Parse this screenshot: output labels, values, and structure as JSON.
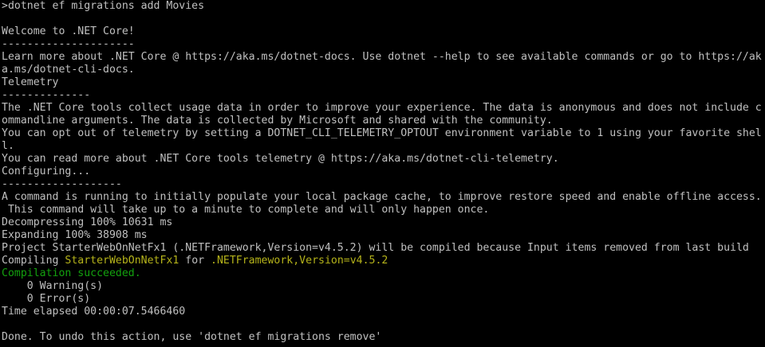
{
  "colors": {
    "background": "#000000",
    "default_text": "#c0c0c0",
    "dark_yellow": "#b5b31a",
    "green": "#13a10e"
  },
  "terminal": {
    "lines": [
      ">dotnet ef migrations add Movies",
      "",
      "Welcome to .NET Core!",
      "---------------------",
      "Learn more about .NET Core @ https://aka.ms/dotnet-docs. Use dotnet --help to see available commands or go to https://ak",
      "a.ms/dotnet-cli-docs.",
      "Telemetry",
      "--------------",
      "The .NET Core tools collect usage data in order to improve your experience. The data is anonymous and does not include c",
      "ommandline arguments. The data is collected by Microsoft and shared with the community.",
      "You can opt out of telemetry by setting a DOTNET_CLI_TELEMETRY_OPTOUT environment variable to 1 using your favorite shel",
      "l.",
      "You can read more about .NET Core tools telemetry @ https://aka.ms/dotnet-cli-telemetry.",
      "Configuring...",
      "-------------------",
      "A command is running to initially populate your local package cache, to improve restore speed and enable offline access.",
      " This command will take up to a minute to complete and will only happen once.",
      "Decompressing 100% 10631 ms",
      "Expanding 100% 38908 ms",
      "Project StarterWebOnNetFx1 (.NETFramework,Version=v4.5.2) will be compiled because Input items removed from last build"
    ],
    "compiling": {
      "prefix": "Compiling ",
      "project": "StarterWebOnNetFx1",
      "middle": " for ",
      "framework": ".NETFramework,Version=v4.5.2"
    },
    "compilation_result": "Compilation succeeded.",
    "tail_lines": [
      "    0 Warning(s)",
      "    0 Error(s)",
      "Time elapsed 00:00:07.5466460",
      "",
      "Done. To undo this action, use 'dotnet ef migrations remove'"
    ]
  }
}
